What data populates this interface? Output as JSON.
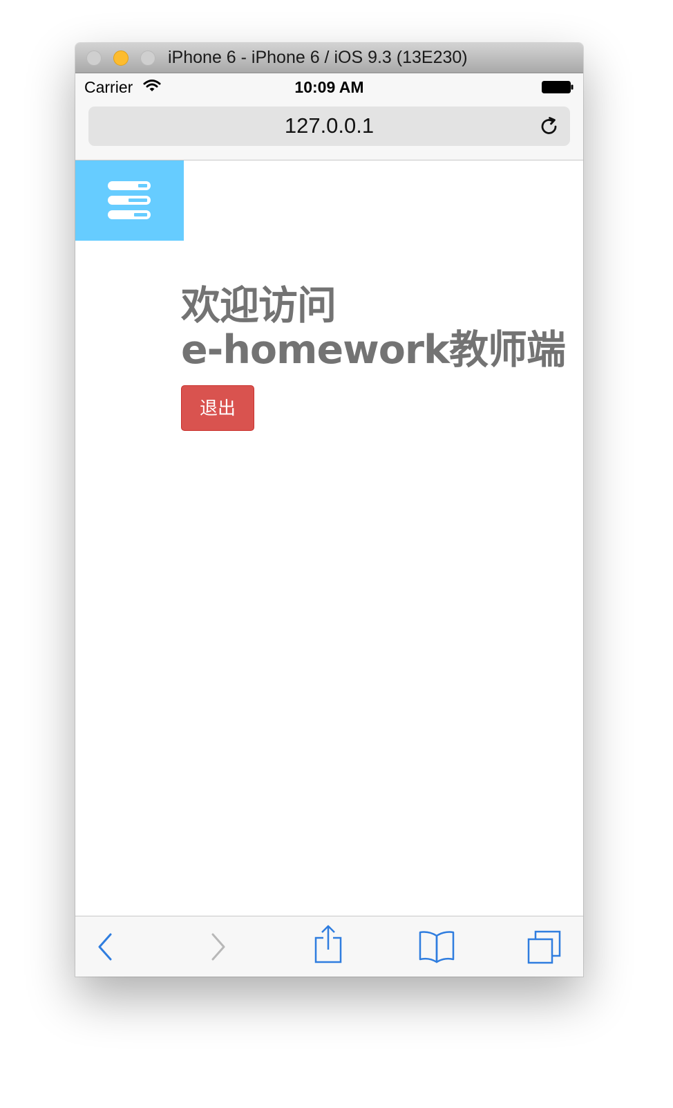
{
  "window": {
    "title": "iPhone 6 - iPhone 6 / iOS 9.3 (13E230)",
    "traffic_lights": [
      "close",
      "minimize",
      "zoom"
    ]
  },
  "statusbar": {
    "carrier": "Carrier",
    "time": "10:09 AM",
    "icons": [
      "wifi-icon",
      "battery-icon"
    ]
  },
  "safari": {
    "url": "127.0.0.1",
    "reload_icon": "reload-icon",
    "toolbar_icons": [
      "back-icon",
      "forward-icon",
      "share-icon",
      "bookmarks-icon",
      "tabs-icon"
    ]
  },
  "page": {
    "menu_icon": "server-stack-icon",
    "welcome_line1": "欢迎访问",
    "welcome_line2": "e-homework教师端",
    "logout_label": "退出"
  },
  "colors": {
    "menu_bg": "#66ccff",
    "logout_bg": "#d9534f",
    "heading_text": "#737373",
    "ios_blue": "#2f7ddf",
    "disabled_gray": "#b8b8b8"
  }
}
